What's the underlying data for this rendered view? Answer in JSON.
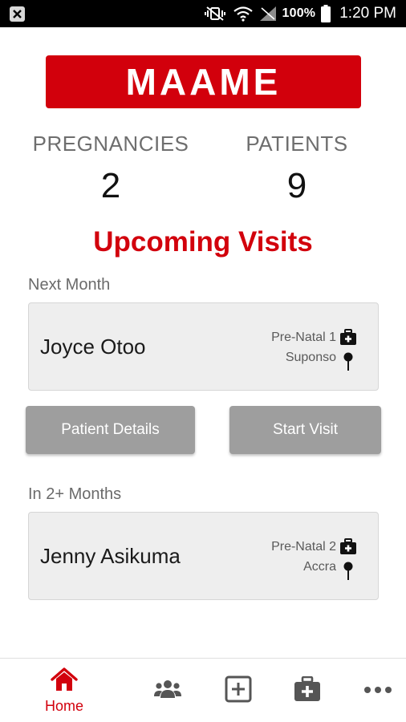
{
  "status_bar": {
    "battery_percent": "100%",
    "time": "1:20 PM"
  },
  "brand": {
    "title": "MAAME",
    "color": "#d2000c"
  },
  "stats": [
    {
      "label": "PREGNANCIES",
      "value": "2"
    },
    {
      "label": "PATIENTS",
      "value": "9"
    }
  ],
  "section_title": "Upcoming Visits",
  "groups": [
    {
      "label": "Next Month",
      "visits": [
        {
          "name": "Joyce Otoo",
          "visit_type": "Pre-Natal 1",
          "location": "Suponso"
        }
      ]
    },
    {
      "label": "In 2+ Months",
      "visits": [
        {
          "name": "Jenny Asikuma",
          "visit_type": "Pre-Natal 2",
          "location": "Accra"
        }
      ]
    }
  ],
  "actions": {
    "patient_details": "Patient Details",
    "start_visit": "Start Visit"
  },
  "bottom_nav": {
    "items": [
      {
        "label": "Home",
        "icon": "home-icon",
        "active": true
      },
      {
        "label": "",
        "icon": "people-icon",
        "active": false
      },
      {
        "label": "",
        "icon": "plus-square-icon",
        "active": false
      },
      {
        "label": "",
        "icon": "medical-kit-icon",
        "active": false
      },
      {
        "label": "",
        "icon": "more-icon",
        "active": false
      }
    ]
  }
}
